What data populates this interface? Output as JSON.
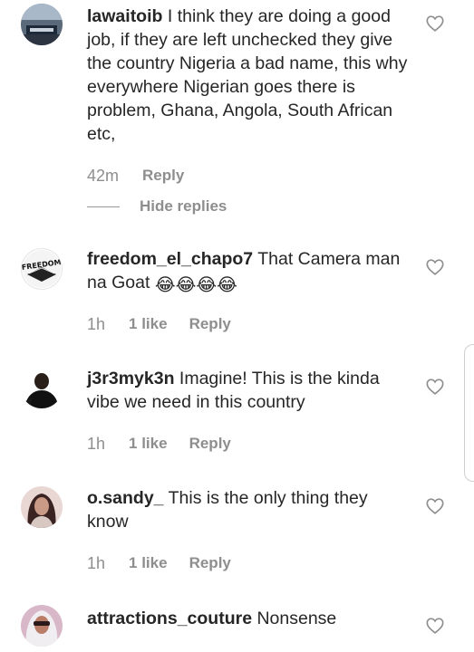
{
  "comments": [
    {
      "username": "lawaitoib",
      "text": " I think they are doing a good job, if they are left unchecked they give the country Nigeria a bad name, this why everywhere Nigerian goes there is problem, Ghana, Angola, South African etc,",
      "time": "42m",
      "likes": "",
      "reply": "Reply",
      "hide_replies": "Hide replies"
    },
    {
      "username": "freedom_el_chapo7",
      "text": " That Camera man na Goat ",
      "emoji": "😂😂😂😂",
      "time": "1h",
      "likes": "1 like",
      "reply": "Reply"
    },
    {
      "username": "j3r3myk3n",
      "text": " Imagine! This is the kinda vibe we need in this country",
      "time": "1h",
      "likes": "1 like",
      "reply": "Reply"
    },
    {
      "username": "o.sandy_",
      "text": " This is the only thing they know",
      "time": "1h",
      "likes": "1 like",
      "reply": "Reply"
    },
    {
      "username": "attractions_couture",
      "text": " Nonsense"
    }
  ],
  "avatar_logos": {
    "freedom": "FREEDOM"
  },
  "colors": {
    "text": "#262626",
    "secondary": "#8e8e8e"
  },
  "icons": [
    "heart-outline-icon"
  ]
}
